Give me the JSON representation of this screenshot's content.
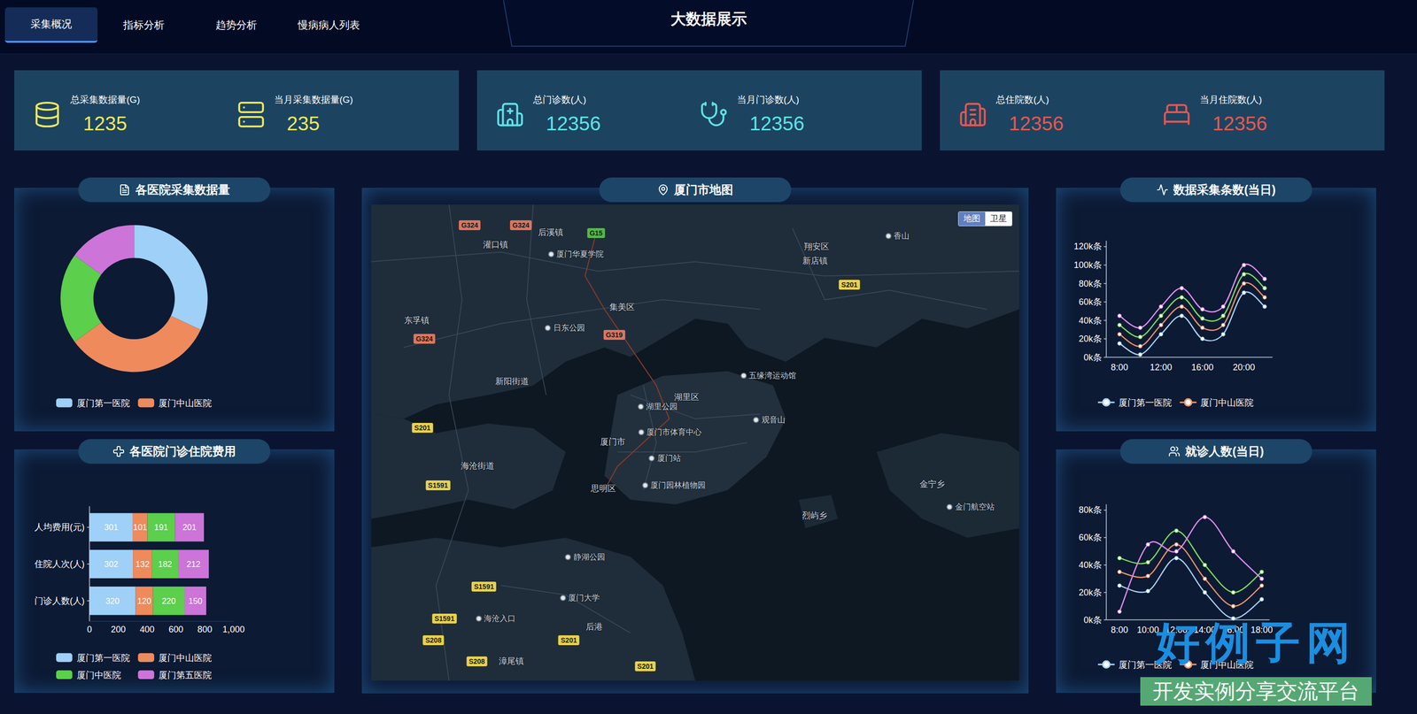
{
  "header": {
    "title": "大数据展示",
    "tabs": [
      {
        "label": "采集概况",
        "selected": true
      },
      {
        "label": "指标分析",
        "selected": false
      },
      {
        "label": "趋势分析",
        "selected": false
      },
      {
        "label": "慢病病人列表",
        "selected": false
      }
    ]
  },
  "stats": [
    {
      "color": "#f2e85c",
      "items": [
        {
          "label": "总采集数据量(G)",
          "value": "1235"
        },
        {
          "label": "当月采集数据量(G)",
          "value": "235"
        }
      ]
    },
    {
      "color": "#5fe3e6",
      "items": [
        {
          "label": "总门诊数(人)",
          "value": "12356"
        },
        {
          "label": "当月门诊数(人)",
          "value": "12356"
        }
      ]
    },
    {
      "color": "#e8574f",
      "items": [
        {
          "label": "总住院数(人)",
          "value": "12356"
        },
        {
          "label": "当月住院数(人)",
          "value": "12356"
        }
      ]
    }
  ],
  "hospital_volume": {
    "title": "各医院采集数据量",
    "series": [
      {
        "name": "厦门第一医院",
        "value": 320,
        "color": "#9fd0f7"
      },
      {
        "name": "厦门中山医院",
        "value": 330,
        "color": "#ef8a5c"
      },
      {
        "name": "厦门中医院",
        "value": 200,
        "color": "#5ccf4c"
      },
      {
        "name": "厦门第五医院",
        "value": 150,
        "color": "#cc74d8"
      }
    ],
    "legend": [
      "厦门第一医院",
      "厦门中山医院"
    ]
  },
  "map": {
    "title": "厦门市地图",
    "toggle": [
      {
        "label": "地图",
        "selected": true
      },
      {
        "label": "卫星",
        "selected": false
      }
    ],
    "labels": [
      {
        "text": "G324",
        "kind": "shield",
        "color": "#e0745a"
      },
      {
        "text": "G324",
        "kind": "shield",
        "color": "#e0745a"
      },
      {
        "text": "G15",
        "kind": "shield",
        "color": "#55b84a"
      },
      {
        "text": "G324",
        "kind": "shield",
        "color": "#e0745a"
      },
      {
        "text": "G319",
        "kind": "shield",
        "color": "#e0745a"
      },
      {
        "text": "S201",
        "kind": "shield",
        "color": "#e8d24a"
      },
      {
        "text": "S201",
        "kind": "shield",
        "color": "#e8d24a"
      },
      {
        "text": "S1591",
        "kind": "shield",
        "color": "#e8d24a"
      },
      {
        "text": "S1591",
        "kind": "shield",
        "color": "#e8d24a"
      },
      {
        "text": "S1591",
        "kind": "shield",
        "color": "#e8d24a"
      },
      {
        "text": "S208",
        "kind": "shield",
        "color": "#e8d24a"
      },
      {
        "text": "S208",
        "kind": "shield",
        "color": "#e8d24a"
      },
      {
        "text": "S201",
        "kind": "shield",
        "color": "#e8d24a"
      },
      {
        "text": "S201",
        "kind": "shield",
        "color": "#e8d24a"
      },
      {
        "text": "灌口镇",
        "kind": "area"
      },
      {
        "text": "后溪镇",
        "kind": "area"
      },
      {
        "text": "厦门华夏学院",
        "kind": "poi"
      },
      {
        "text": "集美区",
        "kind": "area"
      },
      {
        "text": "东孚镇",
        "kind": "area"
      },
      {
        "text": "日东公园",
        "kind": "poi"
      },
      {
        "text": "新阳街道",
        "kind": "area"
      },
      {
        "text": "湖里区",
        "kind": "area"
      },
      {
        "text": "湖里公园",
        "kind": "poi"
      },
      {
        "text": "厦门市体育中心",
        "kind": "poi"
      },
      {
        "text": "厦门市",
        "kind": "area"
      },
      {
        "text": "厦门站",
        "kind": "poi"
      },
      {
        "text": "思明区",
        "kind": "area"
      },
      {
        "text": "厦门园林植物园",
        "kind": "poi"
      },
      {
        "text": "五缘湾运动馆",
        "kind": "poi"
      },
      {
        "text": "观音山",
        "kind": "poi"
      },
      {
        "text": "翔安区",
        "kind": "area"
      },
      {
        "text": "新店镇",
        "kind": "area"
      },
      {
        "text": "香山",
        "kind": "poi"
      },
      {
        "text": "海沧街道",
        "kind": "area"
      },
      {
        "text": "静湖公园",
        "kind": "poi"
      },
      {
        "text": "厦门大学",
        "kind": "poi"
      },
      {
        "text": "海沧入口",
        "kind": "poi"
      },
      {
        "text": "后港",
        "kind": "area"
      },
      {
        "text": "漳尾镇",
        "kind": "area"
      },
      {
        "text": "烈屿乡",
        "kind": "area"
      },
      {
        "text": "金宁乡",
        "kind": "area"
      },
      {
        "text": "金门航空站",
        "kind": "poi"
      }
    ]
  },
  "costs": {
    "title": "各医院门诊住院费用",
    "categories": [
      "人均费用(元)",
      "住院人次(人)",
      "门诊人数(人)"
    ],
    "x_ticks": [
      "0",
      "200",
      "400",
      "600",
      "800",
      "1,000"
    ],
    "x_max": 1000,
    "series": [
      {
        "name": "厦门第一医院",
        "color": "#9fd0f7",
        "values": [
          301,
          302,
          320
        ],
        "labels": [
          "301",
          "302",
          "320"
        ]
      },
      {
        "name": "厦门中山医院",
        "color": "#ef8a5c",
        "values": [
          101,
          132,
          120
        ],
        "labels": [
          "101",
          "132",
          "120"
        ]
      },
      {
        "name": "厦门中医院",
        "color": "#5ccf4c",
        "values": [
          191,
          182,
          220
        ],
        "labels": [
          "191",
          "182",
          "220"
        ]
      },
      {
        "name": "厦门第五医院",
        "color": "#cc74d8",
        "values": [
          201,
          212,
          150
        ],
        "labels": [
          "201",
          "212",
          "150"
        ]
      }
    ]
  },
  "collection": {
    "title": "数据采集条数(当日)",
    "y_ticks": [
      "0k条",
      "20k条",
      "40k条",
      "60k条",
      "80k条",
      "100k条",
      "120k条"
    ],
    "y_max": 120,
    "x_ticks": [
      "8:00",
      "12:00",
      "16:00",
      "20:00"
    ],
    "series": [
      {
        "name": "厦门第一医院",
        "color": "#a9d4f5",
        "values": [
          15,
          3,
          25,
          45,
          20,
          25,
          70,
          55
        ]
      },
      {
        "name": "厦门中山医院",
        "color": "#f0936a",
        "values": [
          25,
          12,
          35,
          55,
          32,
          35,
          80,
          65
        ]
      },
      {
        "name": "厦门中医院",
        "color": "#7de05c",
        "values": [
          35,
          22,
          45,
          65,
          42,
          45,
          90,
          75
        ]
      },
      {
        "name": "厦门第五医院",
        "color": "#e48cf0",
        "values": [
          45,
          32,
          55,
          75,
          52,
          55,
          100,
          85
        ]
      }
    ],
    "legend": [
      "厦门第一医院",
      "厦门中山医院"
    ]
  },
  "visits": {
    "title": "就诊人数(当日)",
    "y_ticks": [
      "0k条",
      "20k条",
      "40k条",
      "60k条",
      "80k条"
    ],
    "y_max": 80,
    "x_ticks": [
      "8:00",
      "10:00",
      "12:00",
      "14:00",
      "16:00",
      "18:00"
    ],
    "series": [
      {
        "name": "厦门第一医院",
        "color": "#a9d4f5",
        "values": [
          25,
          21,
          45,
          20,
          1,
          15
        ]
      },
      {
        "name": "厦门中山医院",
        "color": "#f0936a",
        "values": [
          35,
          32,
          55,
          30,
          10,
          25
        ]
      },
      {
        "name": "厦门中医院",
        "color": "#7de05c",
        "values": [
          45,
          42,
          65,
          40,
          20,
          35
        ]
      },
      {
        "name": "厦门第五医院",
        "color": "#e48cf0",
        "values": [
          6,
          55,
          50,
          75,
          50,
          30
        ]
      }
    ],
    "legend": [
      "厦门第一医院",
      "厦门中山医院"
    ]
  },
  "watermark": {
    "brand": "好例子网",
    "slogan": "开发实例分享交流平台"
  }
}
